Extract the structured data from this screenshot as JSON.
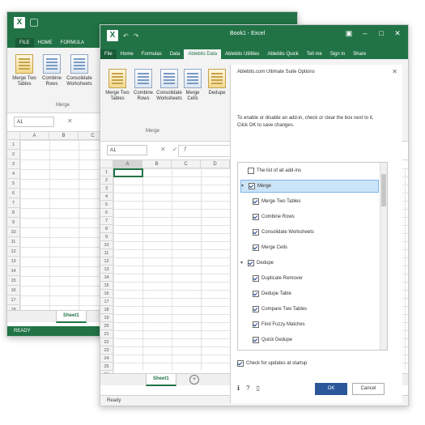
{
  "back_window": {
    "tabs": [
      "FILE",
      "HOME",
      "FORMULA"
    ],
    "ribbon_buttons": [
      {
        "label": "Merge Two Tables",
        "icon": "merge-tables-icon"
      },
      {
        "label": "Combine Rows",
        "icon": "combine-rows-icon"
      },
      {
        "label": "Consolidate Worksheets",
        "icon": "consolidate-icon"
      }
    ],
    "group_label": "Merge",
    "namebox": "A1",
    "columns": [
      "A",
      "B",
      "C"
    ],
    "rows": [
      "1",
      "2",
      "3",
      "4",
      "5",
      "6",
      "7",
      "8",
      "9",
      "10",
      "11",
      "12",
      "13",
      "14",
      "15",
      "16",
      "17",
      "18"
    ],
    "sheet_tab": "Sheet1",
    "status": "READY"
  },
  "front_window": {
    "title": "Book1 - Excel",
    "tabs": [
      "File",
      "Home",
      "Formulas",
      "Data",
      "Ablebits Data",
      "Ablebits Utilities",
      "Ablebits Quick",
      "Tell me",
      "Sign in",
      "Share"
    ],
    "ribbon_buttons": [
      {
        "label": "Merge Two Tables",
        "icon": "merge-tables-icon"
      },
      {
        "label": "Combine Rows",
        "icon": "combine-rows-icon"
      },
      {
        "label": "Consolidate Worksheets",
        "icon": "consolidate-icon"
      },
      {
        "label": "Merge Cells",
        "icon": "merge-cells-icon"
      },
      {
        "label": "Dedupe",
        "icon": "dedupe-icon"
      }
    ],
    "group_label": "Merge",
    "namebox": "A1",
    "columns": [
      "A",
      "B",
      "C",
      "D"
    ],
    "rows": [
      "1",
      "2",
      "3",
      "4",
      "5",
      "6",
      "7",
      "8",
      "9",
      "10",
      "11",
      "12",
      "13",
      "14",
      "15",
      "16",
      "17",
      "18",
      "19",
      "20",
      "21",
      "22",
      "23",
      "24",
      "25",
      "26"
    ],
    "sheet_tab": "Sheet1",
    "status": "Ready"
  },
  "options_pane": {
    "title": "Ablebits.com Ultimate Suite Options",
    "description": "To enable or disable an add-in, check or clear the box next to it. Click OK to save changes.",
    "tree": [
      {
        "label": "The list of all add-ins",
        "checked": false,
        "level": 0,
        "toggle": ""
      },
      {
        "label": "Merge",
        "checked": true,
        "level": 0,
        "toggle": "▾",
        "highlight": true
      },
      {
        "label": "Merge Two Tables",
        "checked": true,
        "level": 1,
        "toggle": ""
      },
      {
        "label": "Combine Rows",
        "checked": true,
        "level": 1,
        "toggle": ""
      },
      {
        "label": "Consolidate Worksheets",
        "checked": true,
        "level": 1,
        "toggle": ""
      },
      {
        "label": "Merge Cells",
        "checked": true,
        "level": 1,
        "toggle": ""
      },
      {
        "label": "Dedupe",
        "checked": true,
        "level": 0,
        "toggle": "▾"
      },
      {
        "label": "Duplicate Remover",
        "checked": true,
        "level": 1,
        "toggle": ""
      },
      {
        "label": "Dedupe Table",
        "checked": true,
        "level": 1,
        "toggle": ""
      },
      {
        "label": "Compare Two Tables",
        "checked": true,
        "level": 1,
        "toggle": ""
      },
      {
        "label": "Find Fuzzy Matches",
        "checked": true,
        "level": 1,
        "toggle": ""
      },
      {
        "label": "Quick Dedupe",
        "checked": true,
        "level": 1,
        "toggle": ""
      }
    ],
    "check_updates": "Check for updates at startup",
    "ok_label": "OK",
    "cancel_label": "Cancel",
    "footer_icons": [
      "info-icon",
      "help-icon",
      "page-icon"
    ]
  }
}
